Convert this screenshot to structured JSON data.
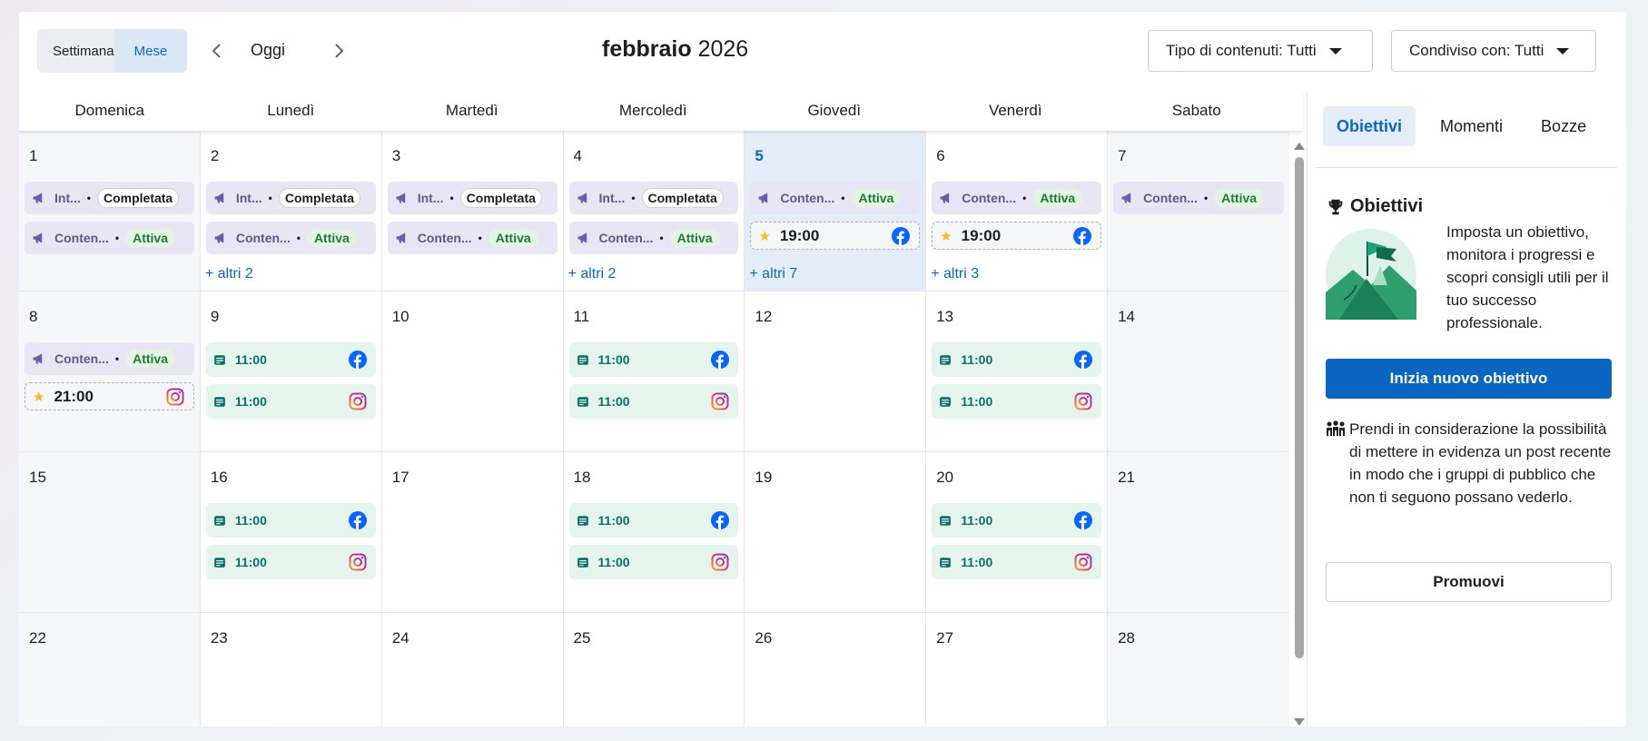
{
  "header": {
    "view_week": "Settimana",
    "view_month": "Mese",
    "today_label": "Oggi",
    "month_name": "febbraio",
    "year": "2026",
    "filter_type": "Tipo di contenuti: Tutti",
    "filter_shared": "Condiviso con: Tutti"
  },
  "weekdays": [
    "Domenica",
    "Lunedì",
    "Martedì",
    "Mercoledì",
    "Giovedì",
    "Venerdì",
    "Sabato"
  ],
  "labels": {
    "ad_short": "Int...",
    "content_short": "Conten...",
    "completed": "Completata",
    "active": "Attiva",
    "dot": "•"
  },
  "weeks": [
    [
      {
        "day": "1",
        "weekend": true,
        "events": [
          {
            "kind": "ad",
            "name": "Int...",
            "status": "Completata"
          },
          {
            "kind": "ad",
            "name": "Conten...",
            "status": "Attiva"
          }
        ]
      },
      {
        "day": "2",
        "events": [
          {
            "kind": "ad",
            "name": "Int...",
            "status": "Completata"
          },
          {
            "kind": "ad",
            "name": "Conten...",
            "status": "Attiva"
          }
        ],
        "more": "+ altri 2"
      },
      {
        "day": "3",
        "events": [
          {
            "kind": "ad",
            "name": "Int...",
            "status": "Completata"
          },
          {
            "kind": "ad",
            "name": "Conten...",
            "status": "Attiva"
          }
        ]
      },
      {
        "day": "4",
        "events": [
          {
            "kind": "ad",
            "name": "Int...",
            "status": "Completata"
          },
          {
            "kind": "ad",
            "name": "Conten...",
            "status": "Attiva"
          }
        ],
        "more": "+ altri 2"
      },
      {
        "day": "5",
        "today": true,
        "events": [
          {
            "kind": "ad",
            "name": "Conten...",
            "status": "Attiva"
          },
          {
            "kind": "story",
            "time": "19:00",
            "network": "facebook"
          }
        ],
        "more": "+ altri 7"
      },
      {
        "day": "6",
        "events": [
          {
            "kind": "ad",
            "name": "Conten...",
            "status": "Attiva"
          },
          {
            "kind": "story",
            "time": "19:00",
            "network": "facebook"
          }
        ],
        "more": "+ altri 3"
      },
      {
        "day": "7",
        "weekend": true,
        "events": [
          {
            "kind": "ad",
            "name": "Conten...",
            "status": "Attiva"
          }
        ]
      }
    ],
    [
      {
        "day": "8",
        "weekend": true,
        "events": [
          {
            "kind": "ad",
            "name": "Conten...",
            "status": "Attiva"
          },
          {
            "kind": "story",
            "time": "21:00",
            "network": "instagram"
          }
        ]
      },
      {
        "day": "9",
        "events": [
          {
            "kind": "post",
            "time": "11:00",
            "network": "facebook"
          },
          {
            "kind": "post",
            "time": "11:00",
            "network": "instagram"
          }
        ]
      },
      {
        "day": "10",
        "events": []
      },
      {
        "day": "11",
        "events": [
          {
            "kind": "post",
            "time": "11:00",
            "network": "facebook"
          },
          {
            "kind": "post",
            "time": "11:00",
            "network": "instagram"
          }
        ]
      },
      {
        "day": "12",
        "events": []
      },
      {
        "day": "13",
        "events": [
          {
            "kind": "post",
            "time": "11:00",
            "network": "facebook"
          },
          {
            "kind": "post",
            "time": "11:00",
            "network": "instagram"
          }
        ]
      },
      {
        "day": "14",
        "weekend": true,
        "events": []
      }
    ],
    [
      {
        "day": "15",
        "weekend": true,
        "events": []
      },
      {
        "day": "16",
        "events": [
          {
            "kind": "post",
            "time": "11:00",
            "network": "facebook"
          },
          {
            "kind": "post",
            "time": "11:00",
            "network": "instagram"
          }
        ]
      },
      {
        "day": "17",
        "events": []
      },
      {
        "day": "18",
        "events": [
          {
            "kind": "post",
            "time": "11:00",
            "network": "facebook"
          },
          {
            "kind": "post",
            "time": "11:00",
            "network": "instagram"
          }
        ]
      },
      {
        "day": "19",
        "events": []
      },
      {
        "day": "20",
        "events": [
          {
            "kind": "post",
            "time": "11:00",
            "network": "facebook"
          },
          {
            "kind": "post",
            "time": "11:00",
            "network": "instagram"
          }
        ]
      },
      {
        "day": "21",
        "weekend": true,
        "events": []
      }
    ],
    [
      {
        "day": "22",
        "weekend": true,
        "events": []
      },
      {
        "day": "23",
        "events": []
      },
      {
        "day": "24",
        "events": []
      },
      {
        "day": "25",
        "events": []
      },
      {
        "day": "26",
        "events": []
      },
      {
        "day": "27",
        "events": []
      },
      {
        "day": "28",
        "weekend": true,
        "events": []
      }
    ]
  ],
  "panel": {
    "tabs": [
      "Obiettivi",
      "Momenti",
      "Bozze"
    ],
    "goal_title": "Obiettivi",
    "goal_desc": "Imposta un obiettivo, monitora i progressi e scopri consigli utili per il tuo successo professionale.",
    "goal_button": "Inizia nuovo obiettivo",
    "promo_text": "Prendi in considerazione la possibilità di mettere in evidenza un post recente in modo che i gruppi di pubblico che non ti seguono possano vederlo.",
    "promo_button": "Promuovi"
  },
  "colors": {
    "accent": "#0a66c2",
    "facebook": "#0866ff",
    "active_green": "#1e7b34",
    "ad_bg": "#e8e6f5",
    "post_bg": "#e6f4ee"
  },
  "icons": {
    "prev": "chevron-left-icon",
    "next": "chevron-right-icon",
    "ad": "megaphone-icon",
    "post": "post-icon",
    "story": "star-icon",
    "goal": "trophy-icon",
    "promo": "audience-icon"
  }
}
